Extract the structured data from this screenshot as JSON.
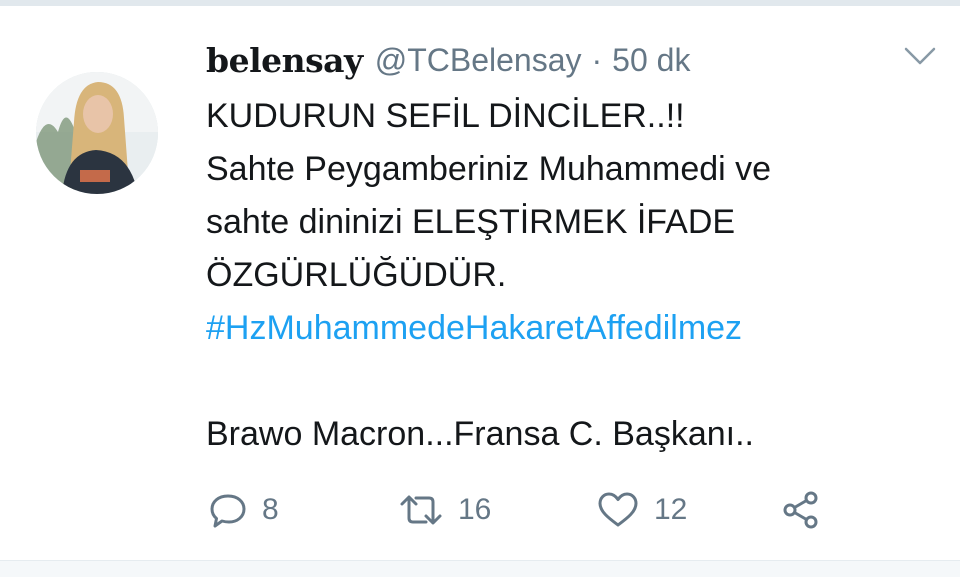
{
  "tweet": {
    "display_name": "belensay",
    "handle": "@TCBelensay",
    "separator": "·",
    "time": "50 dk",
    "lines": [
      "KUDURUN SEFİL DİNCİLER..!!",
      "Sahte Peygamberiniz Muhammedi ve",
      "sahte dininizi ELEŞTİRMEK İFADE",
      "ÖZGÜRLÜĞÜDÜR."
    ],
    "hashtag": "#HzMuhammedeHakaretAffedilmez",
    "closing_line": "Brawo Macron...Fransa C. Başkanı.."
  },
  "actions": {
    "reply_count": "8",
    "retweet_count": "16",
    "like_count": "12"
  },
  "icons": {
    "reply": "reply-icon",
    "retweet": "retweet-icon",
    "like": "heart-icon",
    "share": "share-icon",
    "menu": "chevron-down-icon"
  },
  "colors": {
    "hashtag": "#1da1f2",
    "secondary_text": "#657786",
    "primary_text": "#14171a"
  }
}
